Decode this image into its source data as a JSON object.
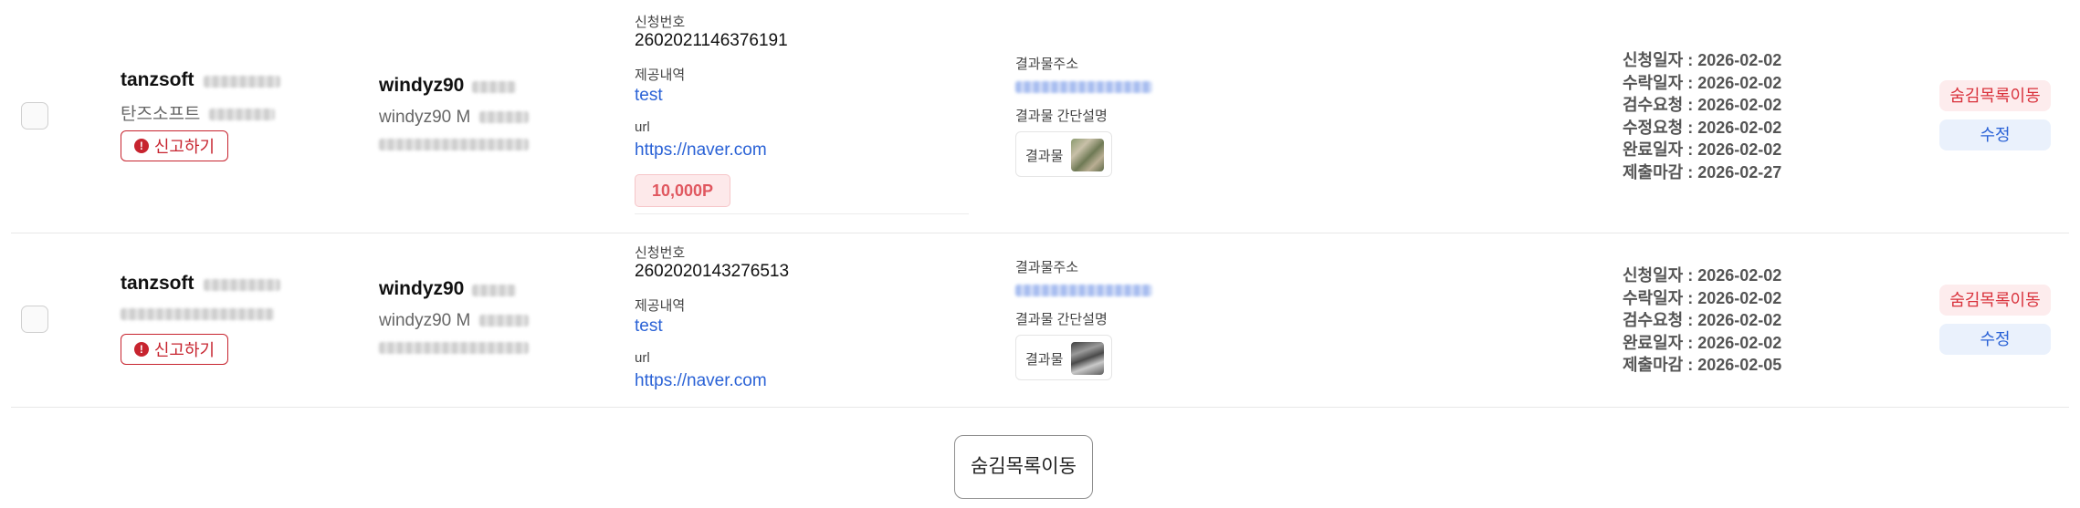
{
  "rows": [
    {
      "seller_name": "tanzsoft",
      "seller_subname": "탄즈소프트",
      "report_label": "신고하기",
      "buyer_id": "windyz90",
      "buyer_sub": "windyz90 M",
      "app_no_label": "신청번호",
      "app_no": "2602021146376191",
      "provided_label": "제공내역",
      "provided_value": "test",
      "url_label": "url",
      "url_value": "https://naver.com",
      "points": "10,000P",
      "result_addr_label": "결과물주소",
      "result_desc_label": "결과물 간단설명",
      "result_thumb_label": "결과물",
      "dates": [
        "신청일자 : 2026-02-02",
        "수락일자 : 2026-02-02",
        "검수요청 : 2026-02-02",
        "수정요청 : 2026-02-02",
        "완료일자 : 2026-02-02",
        "제출마감 : 2026-02-27"
      ],
      "hide_label": "숨김목록이동",
      "edit_label": "수정"
    },
    {
      "seller_name": "tanzsoft",
      "report_label": "신고하기",
      "buyer_id": "windyz90",
      "buyer_sub": "windyz90 M",
      "app_no_label": "신청번호",
      "app_no": "2602020143276513",
      "provided_label": "제공내역",
      "provided_value": "test",
      "url_label": "url",
      "url_value": "https://naver.com",
      "result_addr_label": "결과물주소",
      "result_desc_label": "결과물 간단설명",
      "result_thumb_label": "결과물",
      "dates": [
        "신청일자 : 2026-02-02",
        "수락일자 : 2026-02-02",
        "검수요청 : 2026-02-02",
        "완료일자 : 2026-02-02",
        "제출마감 : 2026-02-05"
      ],
      "hide_label": "숨김목록이동",
      "edit_label": "수정"
    }
  ],
  "bottom_button_label": "숨김목록이동",
  "icons": {
    "report": "alert-circle-icon"
  }
}
